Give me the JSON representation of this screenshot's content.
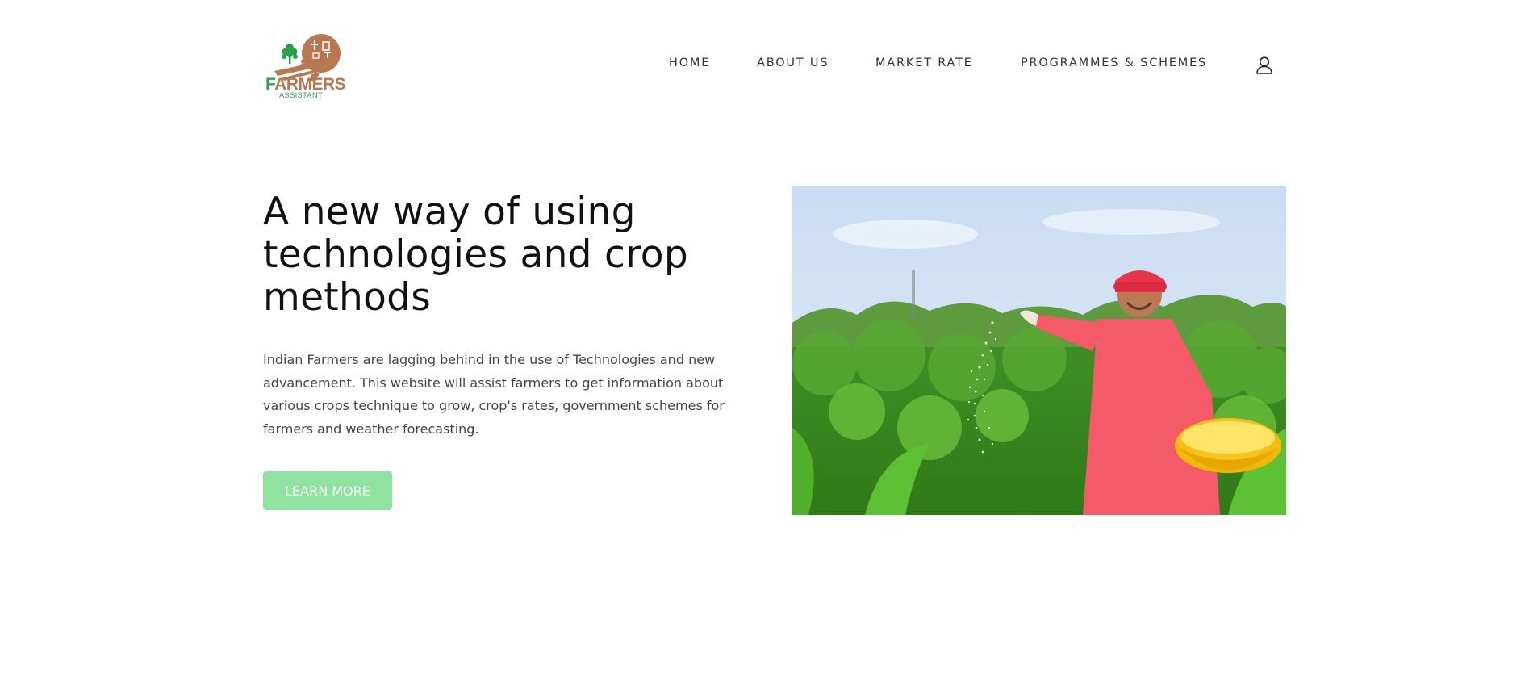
{
  "brand": {
    "name_first_letter": "F",
    "name_rest": "ARMERS",
    "sub": "ASSISTANT",
    "colors": {
      "brown": "#b8784f",
      "green": "#2aa24a"
    }
  },
  "nav": {
    "items": [
      {
        "label": "HOME"
      },
      {
        "label": "ABOUT US"
      },
      {
        "label": "MARKET RATE"
      },
      {
        "label": "PROGRAMMES & SCHEMES"
      }
    ],
    "account_icon": "user-icon"
  },
  "hero": {
    "title": "A new way of using technologies and crop methods",
    "description": "Indian Farmers are lagging behind in the use of Technologies and new advancement. This website will assist farmers to get information about various crops technique to grow, crop's rates, government schemes for farmers and weather forecasting.",
    "button_label": "LEARN MORE",
    "button_color": "#8de39f",
    "image_subject": "farmer-spreading-fertilizer-photo"
  }
}
